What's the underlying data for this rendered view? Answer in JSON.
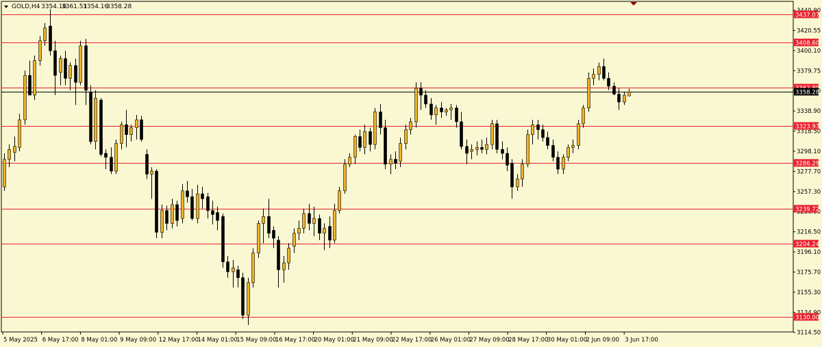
{
  "header": {
    "symbol": "GOLD,H4",
    "open": "3354.16",
    "high": "3361.51",
    "low": "3354.16",
    "close": "3358.28"
  },
  "chart_data": {
    "type": "candlestick",
    "symbol": "GOLD",
    "timeframe": "H4",
    "ylim": [
      3115,
      3450
    ],
    "y_ticks": [
      "3440.90",
      "3420.55",
      "3400.10",
      "3379.75",
      "3359.40",
      "3338.90",
      "3318.50",
      "3298.10",
      "3277.70",
      "3257.30",
      "3236.90",
      "3216.50",
      "3196.10",
      "3175.70",
      "3155.30",
      "3134.90",
      "3114.50"
    ],
    "x_labels": [
      "5 May 2025",
      "6 May 17:00",
      "8 May 01:00",
      "9 May 09:00",
      "12 May 17:00",
      "14 May 01:00",
      "15 May 09:00",
      "16 May 17:00",
      "20 May 01:00",
      "21 May 09:00",
      "22 May 17:00",
      "26 May 01:00",
      "27 May 09:00",
      "28 May 17:00",
      "30 May 01:00",
      "2 Jun 09:00",
      "3 Jun 17:00"
    ],
    "levels": [
      "3437.07",
      "3408.60",
      "3362.89",
      "3323.97",
      "3286.29",
      "3239.72",
      "3204.24",
      "3130.00"
    ],
    "current_price": "3358.28",
    "candles": [
      [
        3262,
        3296,
        3258,
        3290
      ],
      [
        3290,
        3305,
        3282,
        3300
      ],
      [
        3297,
        3313,
        3288,
        3303
      ],
      [
        3302,
        3336,
        3298,
        3330
      ],
      [
        3330,
        3380,
        3325,
        3375
      ],
      [
        3375,
        3390,
        3365,
        3355
      ],
      [
        3355,
        3395,
        3350,
        3390
      ],
      [
        3390,
        3415,
        3385,
        3410
      ],
      [
        3410,
        3428,
        3405,
        3423
      ],
      [
        3425,
        3442,
        3395,
        3400
      ],
      [
        3400,
        3410,
        3355,
        3375
      ],
      [
        3378,
        3395,
        3365,
        3392
      ],
      [
        3392,
        3400,
        3365,
        3372
      ],
      [
        3372,
        3388,
        3360,
        3385
      ],
      [
        3385,
        3392,
        3345,
        3368
      ],
      [
        3368,
        3410,
        3365,
        3405
      ],
      [
        3405,
        3412,
        3345,
        3360
      ],
      [
        3358,
        3365,
        3305,
        3308
      ],
      [
        3308,
        3360,
        3300,
        3352
      ],
      [
        3350,
        3352,
        3293,
        3295
      ],
      [
        3296,
        3300,
        3280,
        3292
      ],
      [
        3292,
        3302,
        3275,
        3278
      ],
      [
        3278,
        3310,
        3275,
        3306
      ],
      [
        3306,
        3328,
        3300,
        3325
      ],
      [
        3325,
        3340,
        3302,
        3315
      ],
      [
        3315,
        3325,
        3308,
        3322
      ],
      [
        3322,
        3335,
        3310,
        3330
      ],
      [
        3330,
        3334,
        3308,
        3310
      ],
      [
        3295,
        3300,
        3270,
        3275
      ],
      [
        3275,
        3282,
        3250,
        3278
      ],
      [
        3278,
        3280,
        3210,
        3216
      ],
      [
        3216,
        3244,
        3210,
        3238
      ],
      [
        3238,
        3243,
        3218,
        3225
      ],
      [
        3225,
        3250,
        3220,
        3244
      ],
      [
        3244,
        3248,
        3222,
        3228
      ],
      [
        3230,
        3265,
        3225,
        3258
      ],
      [
        3258,
        3268,
        3246,
        3252
      ],
      [
        3252,
        3260,
        3228,
        3230
      ],
      [
        3230,
        3264,
        3225,
        3255
      ],
      [
        3255,
        3262,
        3240,
        3250
      ],
      [
        3252,
        3256,
        3230,
        3238
      ],
      [
        3238,
        3248,
        3224,
        3234
      ],
      [
        3236,
        3242,
        3218,
        3228
      ],
      [
        3232,
        3235,
        3180,
        3186
      ],
      [
        3186,
        3192,
        3170,
        3176
      ],
      [
        3176,
        3188,
        3160,
        3180
      ],
      [
        3178,
        3182,
        3160,
        3170
      ],
      [
        3170,
        3175,
        3128,
        3132
      ],
      [
        3132,
        3170,
        3122,
        3165
      ],
      [
        3165,
        3200,
        3160,
        3195
      ],
      [
        3195,
        3228,
        3190,
        3225
      ],
      [
        3225,
        3240,
        3205,
        3232
      ],
      [
        3232,
        3250,
        3210,
        3215
      ],
      [
        3218,
        3222,
        3200,
        3210
      ],
      [
        3208,
        3212,
        3160,
        3178
      ],
      [
        3178,
        3192,
        3165,
        3185
      ],
      [
        3185,
        3205,
        3178,
        3200
      ],
      [
        3202,
        3220,
        3195,
        3215
      ],
      [
        3215,
        3228,
        3208,
        3220
      ],
      [
        3220,
        3240,
        3215,
        3235
      ],
      [
        3235,
        3245,
        3218,
        3225
      ],
      [
        3225,
        3242,
        3212,
        3230
      ],
      [
        3230,
        3234,
        3208,
        3215
      ],
      [
        3215,
        3225,
        3198,
        3220
      ],
      [
        3222,
        3232,
        3200,
        3208
      ],
      [
        3208,
        3245,
        3205,
        3238
      ],
      [
        3238,
        3262,
        3235,
        3258
      ],
      [
        3258,
        3290,
        3255,
        3285
      ],
      [
        3285,
        3296,
        3282,
        3292
      ],
      [
        3292,
        3315,
        3285,
        3313
      ],
      [
        3313,
        3320,
        3298,
        3302
      ],
      [
        3302,
        3325,
        3295,
        3318
      ],
      [
        3318,
        3322,
        3298,
        3305
      ],
      [
        3305,
        3342,
        3300,
        3338
      ],
      [
        3338,
        3346,
        3315,
        3322
      ],
      [
        3322,
        3330,
        3280,
        3285
      ],
      [
        3285,
        3295,
        3275,
        3290
      ],
      [
        3290,
        3298,
        3280,
        3286
      ],
      [
        3288,
        3312,
        3282,
        3306
      ],
      [
        3306,
        3325,
        3300,
        3320
      ],
      [
        3320,
        3332,
        3315,
        3328
      ],
      [
        3328,
        3368,
        3322,
        3362
      ],
      [
        3362,
        3368,
        3340,
        3355
      ],
      [
        3355,
        3360,
        3342,
        3346
      ],
      [
        3346,
        3352,
        3330,
        3335
      ],
      [
        3335,
        3345,
        3325,
        3342
      ],
      [
        3342,
        3348,
        3332,
        3338
      ],
      [
        3338,
        3342,
        3334,
        3340
      ],
      [
        3340,
        3346,
        3330,
        3342
      ],
      [
        3342,
        3345,
        3322,
        3328
      ],
      [
        3328,
        3338,
        3300,
        3303
      ],
      [
        3303,
        3310,
        3285,
        3296
      ],
      [
        3298,
        3305,
        3290,
        3300
      ],
      [
        3300,
        3308,
        3294,
        3302
      ],
      [
        3302,
        3310,
        3296,
        3300
      ],
      [
        3300,
        3312,
        3295,
        3305
      ],
      [
        3305,
        3330,
        3300,
        3326
      ],
      [
        3326,
        3330,
        3296,
        3300
      ],
      [
        3300,
        3308,
        3290,
        3296
      ],
      [
        3296,
        3302,
        3278,
        3284
      ],
      [
        3286,
        3290,
        3250,
        3262
      ],
      [
        3262,
        3275,
        3258,
        3270
      ],
      [
        3270,
        3290,
        3262,
        3285
      ],
      [
        3285,
        3320,
        3282,
        3315
      ],
      [
        3315,
        3330,
        3305,
        3325
      ],
      [
        3325,
        3330,
        3310,
        3320
      ],
      [
        3320,
        3325,
        3308,
        3312
      ],
      [
        3312,
        3318,
        3300,
        3304
      ],
      [
        3304,
        3310,
        3288,
        3292
      ],
      [
        3292,
        3298,
        3275,
        3280
      ],
      [
        3280,
        3295,
        3275,
        3292
      ],
      [
        3292,
        3305,
        3288,
        3302
      ],
      [
        3302,
        3310,
        3296,
        3304
      ],
      [
        3304,
        3330,
        3300,
        3326
      ],
      [
        3326,
        3345,
        3322,
        3342
      ],
      [
        3342,
        3378,
        3338,
        3372
      ],
      [
        3372,
        3382,
        3365,
        3376
      ],
      [
        3376,
        3388,
        3370,
        3384
      ],
      [
        3384,
        3392,
        3370,
        3372
      ],
      [
        3372,
        3378,
        3360,
        3364
      ],
      [
        3364,
        3368,
        3355,
        3356
      ],
      [
        3356,
        3362,
        3340,
        3348
      ],
      [
        3348,
        3358,
        3345,
        3355
      ],
      [
        3354.16,
        3361.51,
        3354.16,
        3358.28
      ]
    ]
  },
  "colors": {
    "background": "#FAF8D2",
    "bull": "#F0B22A",
    "bear": "#000000",
    "level_line": "#E8202C",
    "level_label_bg": "#E8202C",
    "price_label_bg": "#000000"
  }
}
